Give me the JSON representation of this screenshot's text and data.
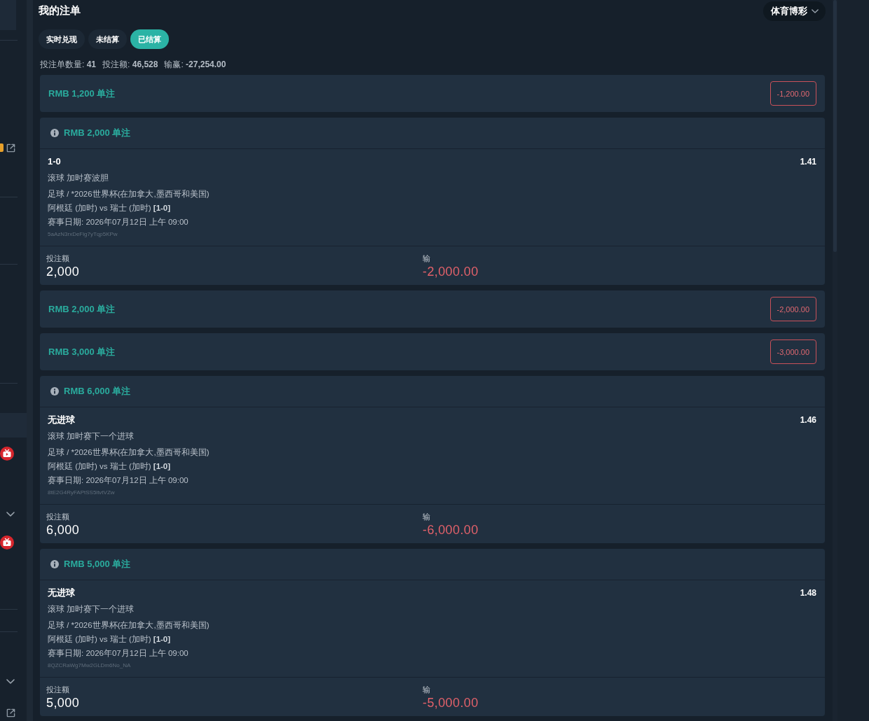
{
  "header": {
    "title": "我的注单",
    "product_dropdown": "体育博彩"
  },
  "tabs": [
    {
      "label": "实时兑现",
      "selected": false
    },
    {
      "label": "未结算",
      "selected": false
    },
    {
      "label": "已结算",
      "selected": true
    }
  ],
  "summary": [
    "投注单数量: **41**",
    "投注额: **46,528**",
    "输赢: **-27,254.00**"
  ],
  "bets": [
    {
      "kind": "collapsed",
      "title": "RMB 1,200 单注",
      "result": "-1,200.00"
    },
    {
      "kind": "expanded",
      "title": "RMB 2,000 单注",
      "selection": "1-0",
      "odds": "1.41",
      "market": "滚球 加时赛波胆",
      "league": "足球 / *2026世界杯(在加拿大,墨西哥和美国)",
      "match": "阿根廷 (加时) vs 瑞士 (加时) **[1-0]**",
      "date": "赛事日期: 2026年07月12日 上午 09:00",
      "reference": "5aAzN3rxDeFlg7yTqp5KPw",
      "stake_label": "投注额",
      "stake": "2,000",
      "result_label": "输",
      "result": "-2,000.00"
    },
    {
      "kind": "collapsed",
      "title": "RMB 2,000 单注",
      "result": "-2,000.00"
    },
    {
      "kind": "collapsed",
      "title": "RMB 3,000 单注",
      "result": "-3,000.00"
    },
    {
      "kind": "expanded",
      "title": "RMB 6,000 单注",
      "selection": "无进球",
      "odds": "1.46",
      "market": "滚球 加时赛下一个进球",
      "league": "足球 / *2026世界杯(在加拿大,墨西哥和美国)",
      "match": "阿根廷 (加时) vs 瑞士 (加时) **[1-0]**",
      "date": "赛事日期: 2026年07月12日 上午 09:00",
      "reference": "8tE2G4RyFAPtSS5ltvtVZw",
      "stake_label": "投注额",
      "stake": "6,000",
      "result_label": "输",
      "result": "-6,000.00"
    },
    {
      "kind": "expanded",
      "title": "RMB 5,000 单注",
      "selection": "无进球",
      "odds": "1.48",
      "market": "滚球 加时赛下一个进球",
      "league": "足球 / *2026世界杯(在加拿大,墨西哥和美国)",
      "match": "阿根廷 (加时) vs 瑞士 (加时) **[1-0]**",
      "date": "赛事日期: 2026年07月12日 上午 09:00",
      "reference": "8QZCRaWg7Mw2GLDm6No_NA",
      "stake_label": "投注额",
      "stake": "5,000",
      "result_label": "输",
      "result": "-5,000.00"
    }
  ]
}
